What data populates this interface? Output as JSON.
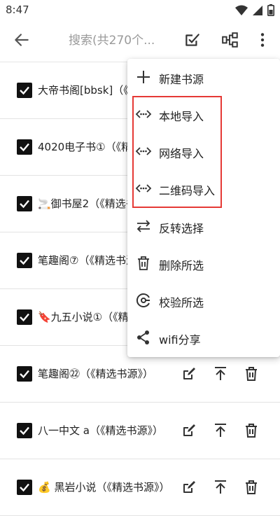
{
  "status_bar": {
    "time": "8:47"
  },
  "toolbar": {
    "search_placeholder": "搜索(共270个..."
  },
  "sources": [
    {
      "name": "大帝书阁[bbsk]（《精选书源》）",
      "checked": true
    },
    {
      "name": "4020电子书①（《精选书源》）",
      "checked": true
    },
    {
      "name": "🚬御书屋2（《精选书源》）",
      "checked": true
    },
    {
      "name": "笔趣阁⑦（《精选书源》）",
      "checked": true
    },
    {
      "name": "🔖九五小说①（《精选书源》）",
      "checked": true
    },
    {
      "name": "笔趣阁㉒（《精选书源》）",
      "checked": true
    },
    {
      "name": "八一中文 a（《精选书源》）",
      "checked": true
    },
    {
      "name": "💰 黑岩小说（《精选书源》）",
      "checked": true
    }
  ],
  "menu": {
    "items": [
      {
        "label": "新建书源",
        "icon": "plus-icon"
      },
      {
        "label": "本地导入",
        "icon": "import-icon"
      },
      {
        "label": "网络导入",
        "icon": "import-icon"
      },
      {
        "label": "二维码导入",
        "icon": "import-icon"
      },
      {
        "label": "反转选择",
        "icon": "swap-icon"
      },
      {
        "label": "删除所选",
        "icon": "trash-icon"
      },
      {
        "label": "校验所选",
        "icon": "check-source-icon"
      },
      {
        "label": "wifi分享",
        "icon": "share-icon"
      }
    ]
  },
  "colors": {
    "highlight": "#e53935",
    "text": "#222222",
    "checkbox": "#111111"
  }
}
